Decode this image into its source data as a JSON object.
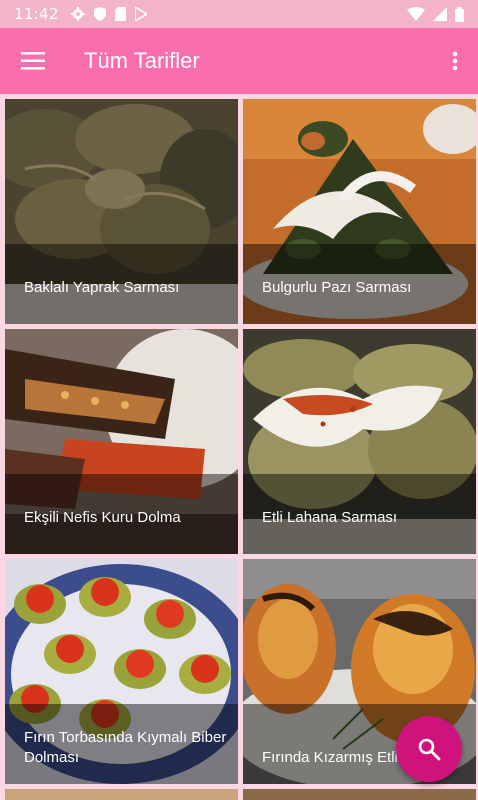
{
  "status_bar": {
    "time": "11:42",
    "icons": [
      "gear-icon",
      "shield-icon",
      "sd-card-icon",
      "play-store-icon"
    ],
    "right_icons": [
      "wifi-icon",
      "signal-icon",
      "battery-icon"
    ]
  },
  "app_bar": {
    "title": "Tüm Tarifler",
    "background": "#fb6eae",
    "menu_icon": "hamburger-icon",
    "overflow_icon": "more-vert-icon"
  },
  "recipes": [
    {
      "name": "Baklalı Yaprak Sarması"
    },
    {
      "name": "Bulgurlu Pazı Sarması"
    },
    {
      "name": "Ekşili Nefis Kuru Dolma"
    },
    {
      "name": "Etli Lahana Sarması"
    },
    {
      "name": "Fırın Torbasında Kıymalı Biber Dolması"
    },
    {
      "name": "Fırında Kızarmış Etli Dolması"
    }
  ],
  "fab": {
    "icon": "search-icon",
    "color": "#d0137c"
  }
}
